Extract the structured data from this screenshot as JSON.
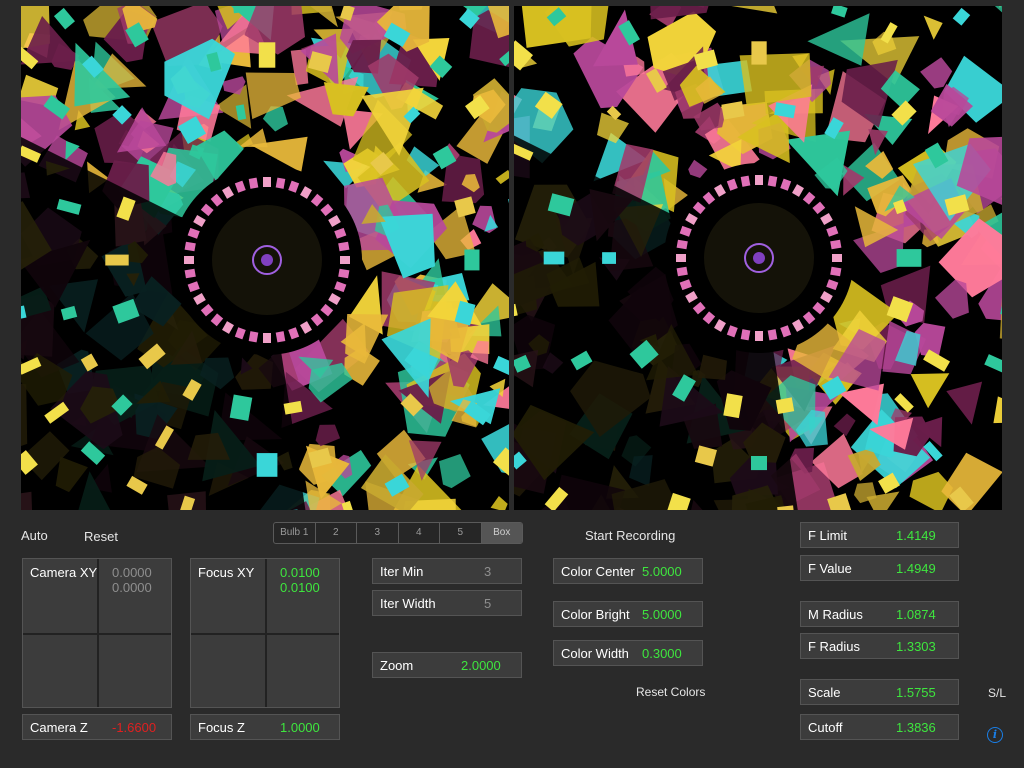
{
  "toolbar": {
    "auto_label": "Auto",
    "reset_label": "Reset",
    "start_recording_label": "Start Recording"
  },
  "bulb_selector": {
    "options": [
      "Bulb 1",
      "2",
      "3",
      "4",
      "5",
      "Box"
    ],
    "selected": "Box"
  },
  "camera_xy": {
    "label": "Camera XY",
    "x": "0.0000",
    "y": "0.0000"
  },
  "focus_xy": {
    "label": "Focus XY",
    "x": "0.0100",
    "y": "0.0100"
  },
  "camera_z": {
    "label": "Camera Z",
    "value": "-1.6600"
  },
  "focus_z": {
    "label": "Focus Z",
    "value": "1.0000"
  },
  "iter_min": {
    "label": "Iter Min",
    "value": "3"
  },
  "iter_width": {
    "label": "Iter Width",
    "value": "5"
  },
  "zoom": {
    "label": "Zoom",
    "value": "2.0000"
  },
  "color_center": {
    "label": "Color Center",
    "value": "5.0000"
  },
  "color_bright": {
    "label": "Color Bright",
    "value": "5.0000"
  },
  "color_width": {
    "label": "Color Width",
    "value": "0.3000"
  },
  "reset_colors_label": "Reset Colors",
  "f_limit": {
    "label": "F Limit",
    "value": "1.4149"
  },
  "f_value": {
    "label": "F Value",
    "value": "1.4949"
  },
  "m_radius": {
    "label": "M Radius",
    "value": "1.0874"
  },
  "f_radius": {
    "label": "F Radius",
    "value": "1.3303"
  },
  "scale": {
    "label": "Scale",
    "value": "1.5755"
  },
  "cutoff": {
    "label": "Cutoff",
    "value": "1.3836"
  },
  "sl_label": "S/L",
  "colors": {
    "background": "#2a2a2a",
    "widget": "#3c3c3c",
    "value_green": "#3ee63e",
    "value_red": "#e02020",
    "value_gray": "#8e8e8e",
    "info_blue": "#1a7ee6"
  },
  "icons": {
    "info": "info-icon"
  }
}
